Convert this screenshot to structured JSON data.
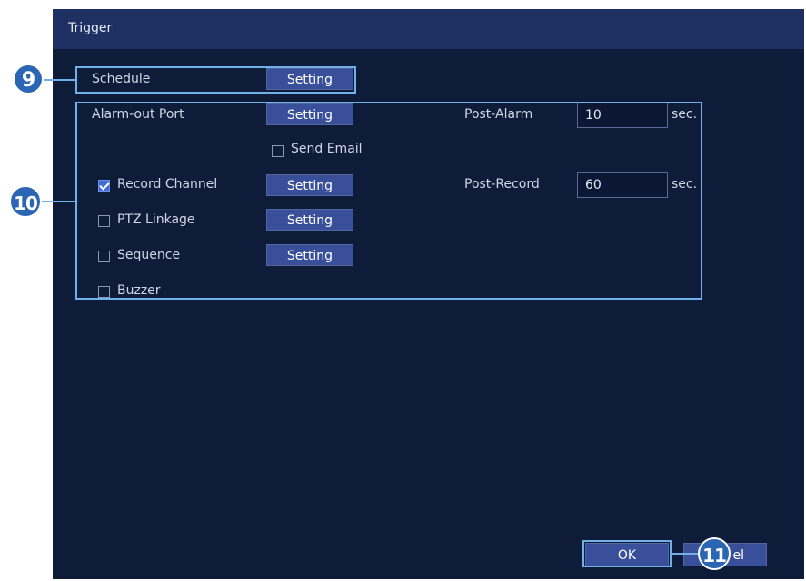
{
  "window": {
    "title": "Trigger"
  },
  "schedule": {
    "label": "Schedule",
    "button": "Setting"
  },
  "alarm_out": {
    "label": "Alarm-out Port",
    "button": "Setting"
  },
  "send_email": {
    "label": "Send Email",
    "checked": false
  },
  "record_channel": {
    "label": "Record Channel",
    "button": "Setting",
    "checked": true
  },
  "ptz_linkage": {
    "label": "PTZ Linkage",
    "button": "Setting",
    "checked": false
  },
  "sequence": {
    "label": "Sequence",
    "button": "Setting",
    "checked": false
  },
  "buzzer": {
    "label": "Buzzer",
    "checked": false
  },
  "post_alarm": {
    "label": "Post-Alarm",
    "value": "10",
    "unit": "sec."
  },
  "post_record": {
    "label": "Post-Record",
    "value": "60",
    "unit": "sec."
  },
  "footer": {
    "ok": "OK",
    "cancel_partial": "el"
  },
  "callouts": {
    "c9": "9",
    "c10": "10",
    "c11": "11"
  },
  "colors": {
    "accent": "#6fb0e8",
    "button": "#3a4f9a",
    "background": "#0e1c3a",
    "callout": "#2b66b4"
  }
}
